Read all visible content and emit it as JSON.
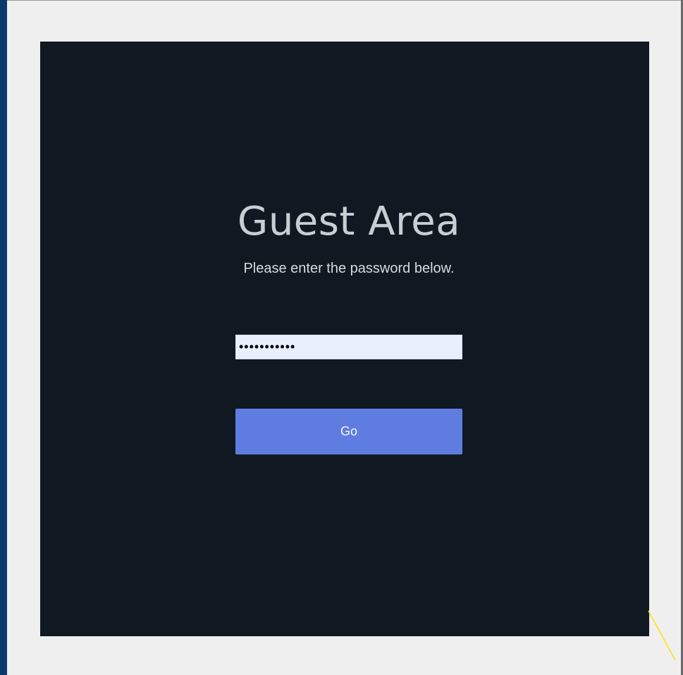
{
  "guest_area": {
    "title": "Guest Area",
    "subtitle": "Please enter the password below.",
    "password_value": "•••••••••••",
    "go_label": "Go"
  },
  "colors": {
    "panel_background": "#101922",
    "page_background": "#efefef",
    "button_background": "#5f7de0",
    "input_background": "#e8f0fe"
  }
}
